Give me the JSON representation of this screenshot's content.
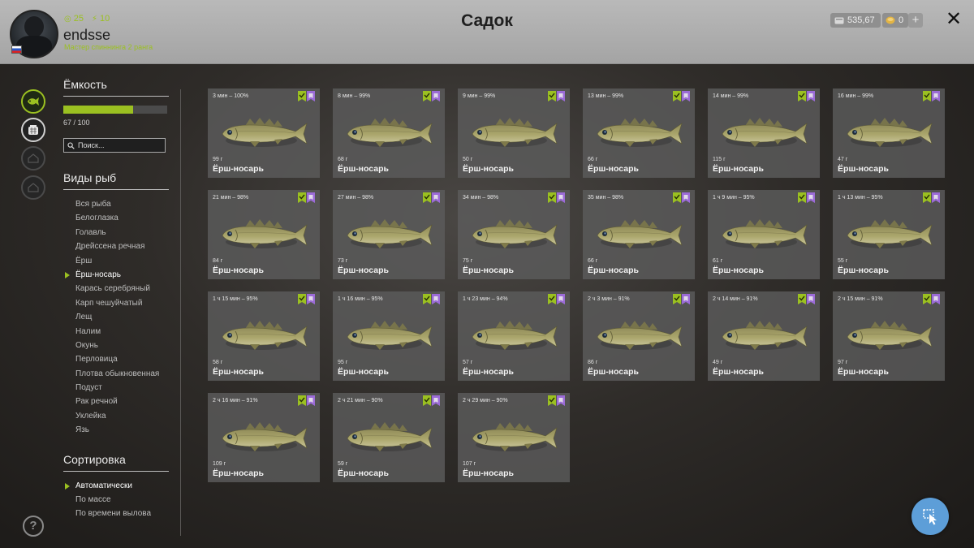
{
  "header": {
    "title": "Садок",
    "username": "endsse",
    "rank": "Мастер спиннинга 2 ранга",
    "stat_silver": "25",
    "stat_energy": "10",
    "money": "535,67",
    "coins": "0",
    "plus_label": "+",
    "close_label": "✕"
  },
  "capacity": {
    "label": "Ёмкость",
    "current": 67,
    "max": 100,
    "fill_fraction": 0.67,
    "text": "67 / 100"
  },
  "search": {
    "placeholder": "Поиск..."
  },
  "species": {
    "title": "Виды рыб",
    "items": [
      "Вся рыба",
      "Белоглазка",
      "Голавль",
      "Дрейссена речная",
      "Ёрш",
      "Ёрш-носарь",
      "Карась серебряный",
      "Карп чешуйчатый",
      "Лещ",
      "Налим",
      "Окунь",
      "Перловица",
      "Плотва обыкновенная",
      "Подуст",
      "Рак речной",
      "Уклейка",
      "Язь"
    ],
    "selected": "Ёрш-носарь"
  },
  "sort": {
    "title": "Сортировка",
    "items": [
      "Автоматически",
      "По массе",
      "По времени вылова"
    ],
    "selected": "Автоматически"
  },
  "fish_cards": [
    {
      "time": "3 мин – 100%",
      "weight": "99 г",
      "name": "Ёрш-носарь"
    },
    {
      "time": "8 мин – 99%",
      "weight": "68 г",
      "name": "Ёрш-носарь"
    },
    {
      "time": "9 мин – 99%",
      "weight": "50 г",
      "name": "Ёрш-носарь"
    },
    {
      "time": "13 мин – 99%",
      "weight": "66 г",
      "name": "Ёрш-носарь"
    },
    {
      "time": "14 мин – 99%",
      "weight": "115 г",
      "name": "Ёрш-носарь"
    },
    {
      "time": "16 мин – 99%",
      "weight": "47 г",
      "name": "Ёрш-носарь"
    },
    {
      "time": "21 мин – 98%",
      "weight": "84 г",
      "name": "Ёрш-носарь"
    },
    {
      "time": "27 мин – 98%",
      "weight": "73 г",
      "name": "Ёрш-носарь"
    },
    {
      "time": "34 мин – 98%",
      "weight": "75 г",
      "name": "Ёрш-носарь"
    },
    {
      "time": "35 мин – 98%",
      "weight": "66 г",
      "name": "Ёрш-носарь"
    },
    {
      "time": "1 ч 9 мин – 95%",
      "weight": "61 г",
      "name": "Ёрш-носарь"
    },
    {
      "time": "1 ч 13 мин – 95%",
      "weight": "55 г",
      "name": "Ёрш-носарь"
    },
    {
      "time": "1 ч 15 мин – 95%",
      "weight": "58 г",
      "name": "Ёрш-носарь"
    },
    {
      "time": "1 ч 16 мин – 95%",
      "weight": "95 г",
      "name": "Ёрш-носарь"
    },
    {
      "time": "1 ч 23 мин – 94%",
      "weight": "57 г",
      "name": "Ёрш-носарь"
    },
    {
      "time": "2 ч 3 мин – 91%",
      "weight": "86 г",
      "name": "Ёрш-носарь"
    },
    {
      "time": "2 ч 14 мин – 91%",
      "weight": "49 г",
      "name": "Ёрш-носарь"
    },
    {
      "time": "2 ч 15 мин – 91%",
      "weight": "97 г",
      "name": "Ёрш-носарь"
    },
    {
      "time": "2 ч 16 мин – 91%",
      "weight": "109 г",
      "name": "Ёрш-носарь"
    },
    {
      "time": "2 ч 21 мин – 90%",
      "weight": "59 г",
      "name": "Ёрш-носарь"
    },
    {
      "time": "2 ч 29 мин – 90%",
      "weight": "107 г",
      "name": "Ёрш-носарь"
    }
  ],
  "colors": {
    "accent": "#9bc021",
    "badge_green": "#9bc021",
    "badge_purple": "#9b6bd6",
    "fab_blue": "#5d9ed8"
  },
  "icons": {
    "rail": [
      "fish-icon",
      "keepnet-icon",
      "house-icon",
      "house-icon"
    ],
    "help": "question-icon",
    "fab": "cursor-icon"
  }
}
